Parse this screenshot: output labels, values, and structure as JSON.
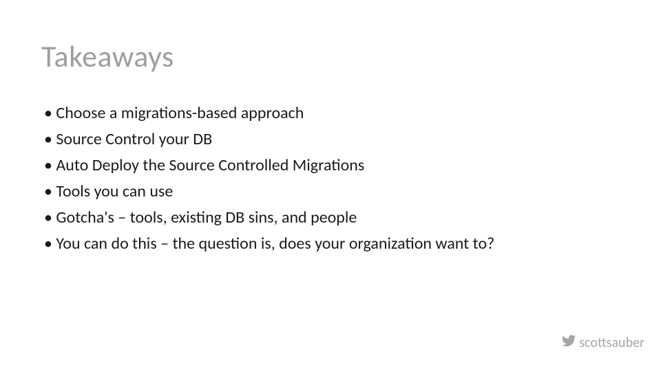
{
  "title": "Takeaways",
  "bullets": [
    "Choose a migrations-based approach",
    "Source Control your DB",
    "Auto Deploy the Source Controlled Migrations",
    "Tools you can use",
    "Gotcha's – tools, existing DB sins, and people",
    "You can do this – the question is, does your organization want to?"
  ],
  "footer": {
    "icon": "twitter-icon",
    "handle": "scottsauber"
  }
}
